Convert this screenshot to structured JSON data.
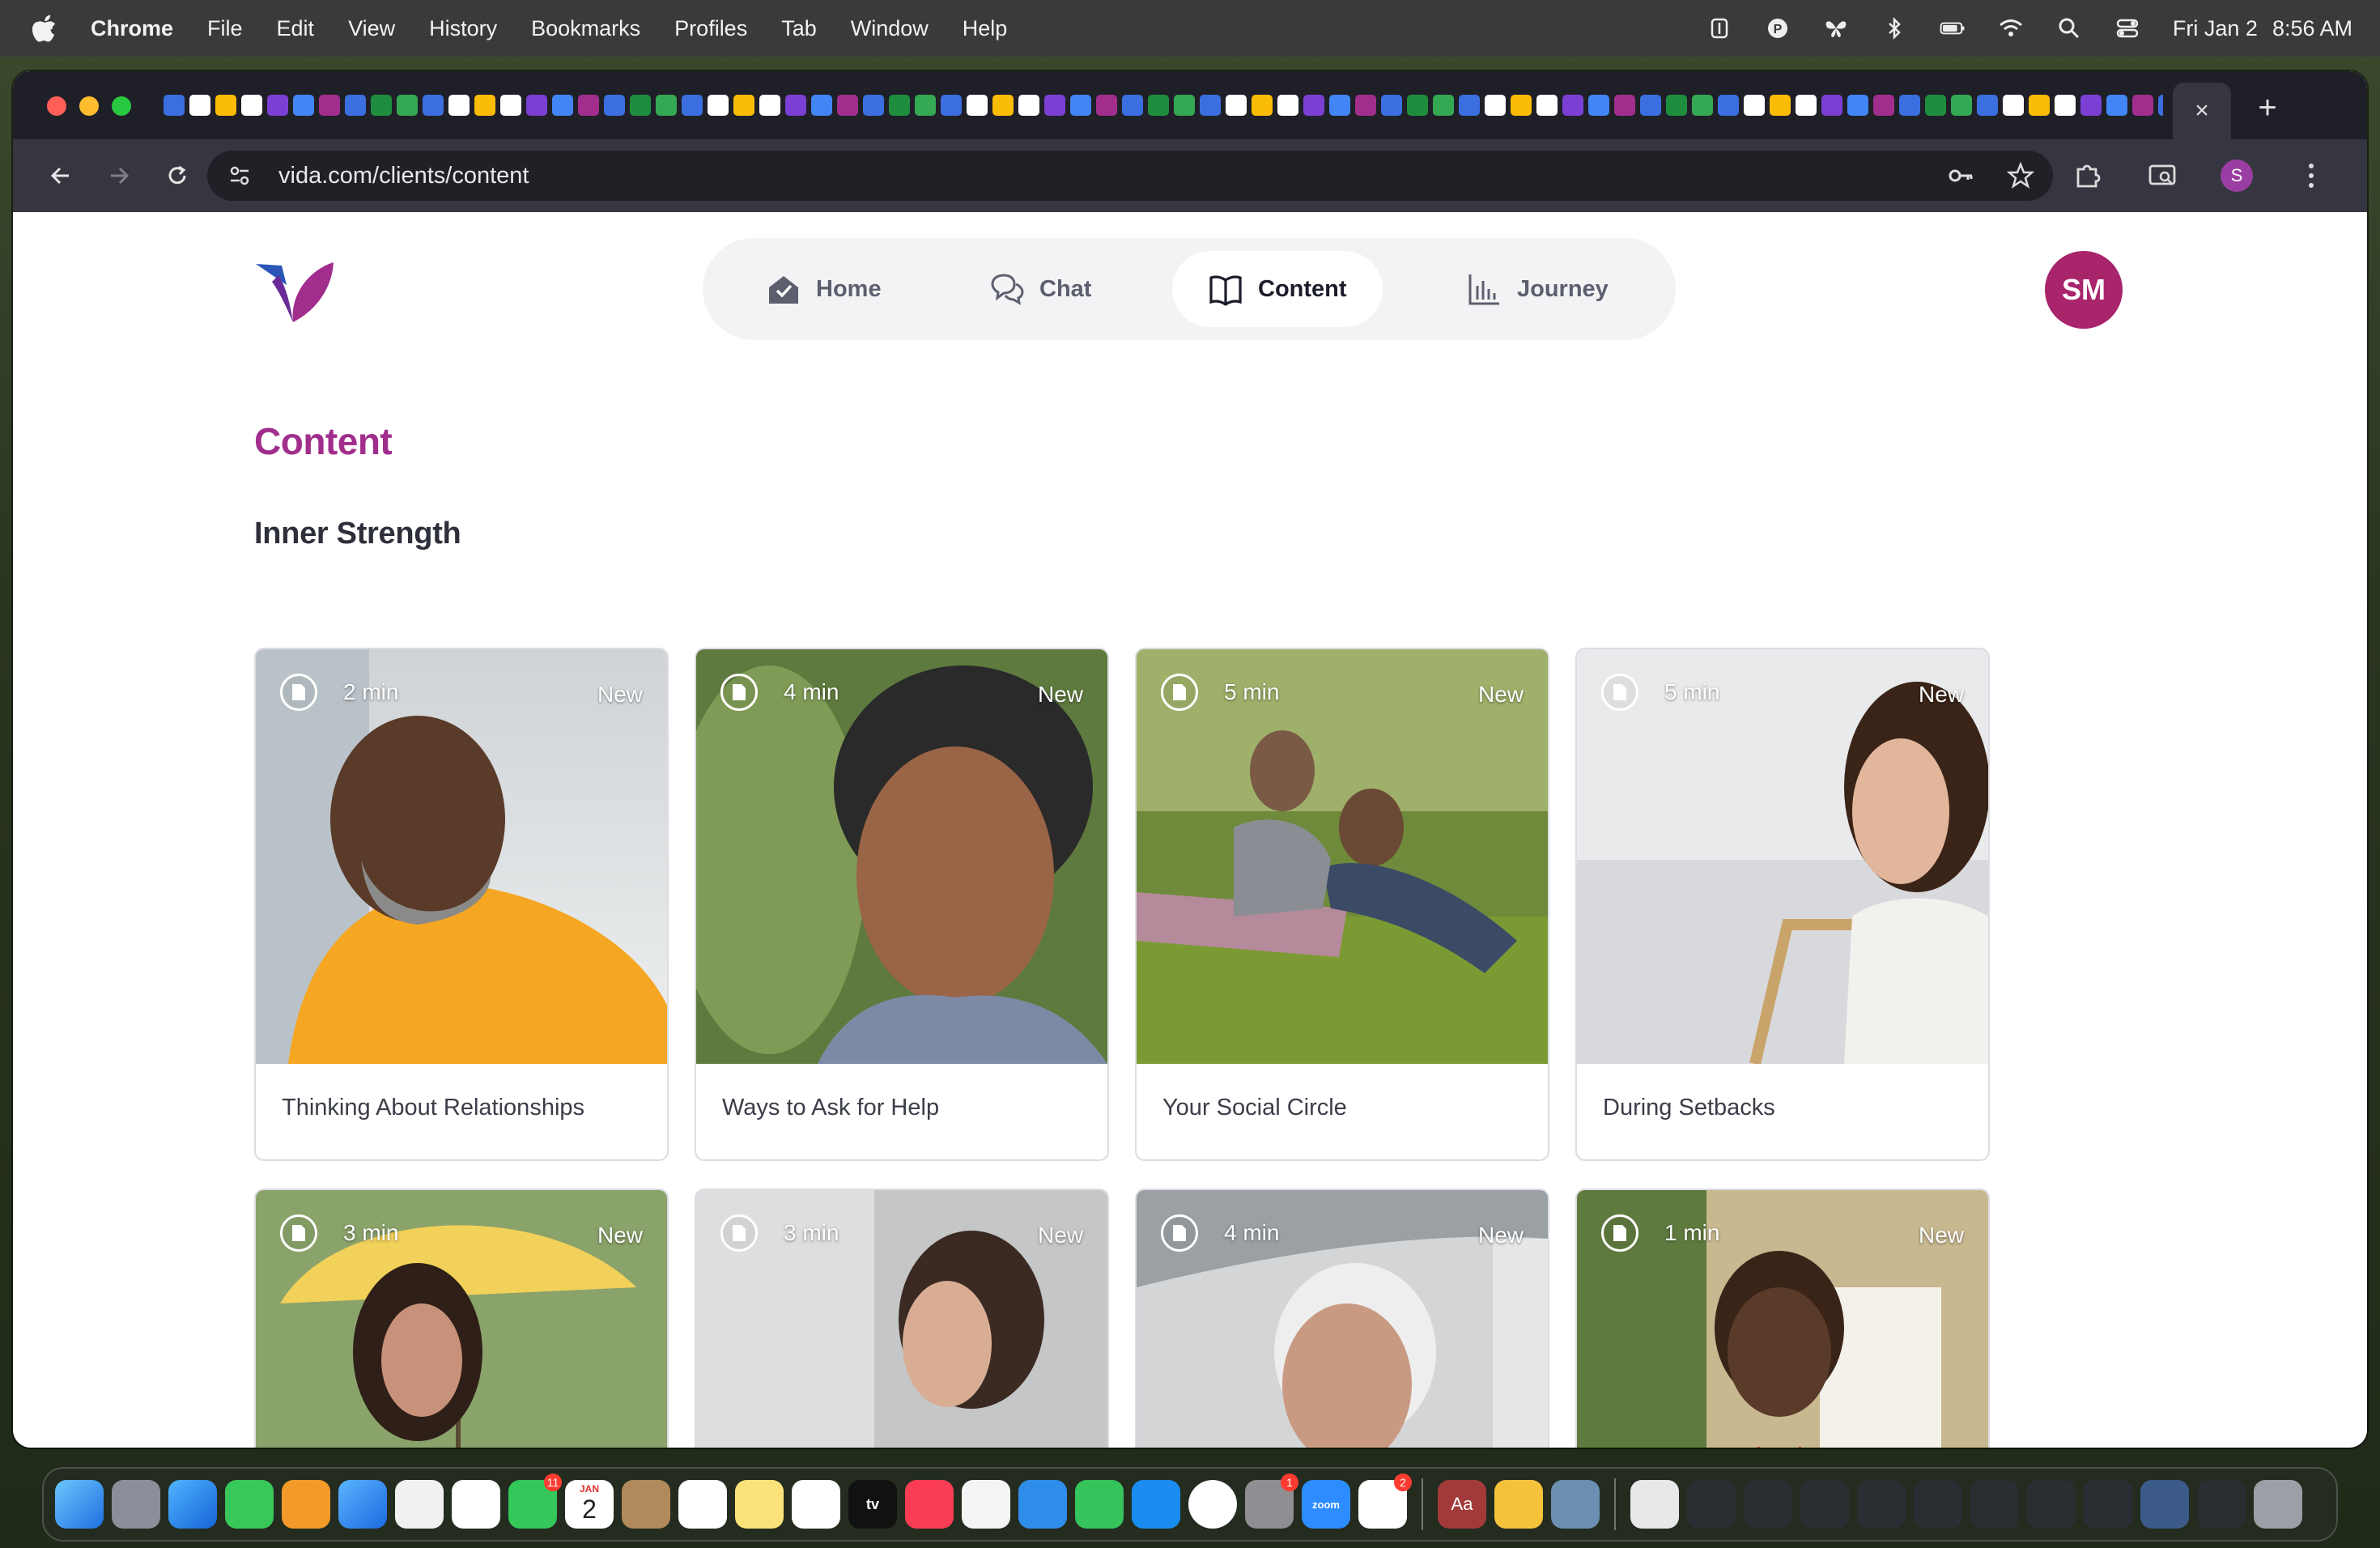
{
  "menubar": {
    "app_name": "Chrome",
    "items": [
      "File",
      "Edit",
      "View",
      "History",
      "Bookmarks",
      "Profiles",
      "Tab",
      "Window",
      "Help"
    ],
    "date": "Fri Jan 2",
    "time": "8:56 AM"
  },
  "browser": {
    "url": "vida.com/clients/content",
    "profile_initial": "S",
    "tab_close": "×",
    "new_tab": "+"
  },
  "nav": {
    "items": [
      {
        "label": "Home",
        "icon": "home-icon"
      },
      {
        "label": "Chat",
        "icon": "chat-icon"
      },
      {
        "label": "Content",
        "icon": "book-icon",
        "active": true
      },
      {
        "label": "Journey",
        "icon": "bar-chart-icon"
      }
    ],
    "avatar_initials": "SM"
  },
  "page": {
    "title": "Content",
    "section_title": "Inner Strength"
  },
  "cards": [
    {
      "duration": "2 min",
      "badge": "New",
      "title": "Thinking About Relationships"
    },
    {
      "duration": "4 min",
      "badge": "New",
      "title": "Ways to Ask for Help"
    },
    {
      "duration": "5 min",
      "badge": "New",
      "title": "Your Social Circle"
    },
    {
      "duration": "5 min",
      "badge": "New",
      "title": "During Setbacks"
    },
    {
      "duration": "3 min",
      "badge": "New",
      "title": ""
    },
    {
      "duration": "3 min",
      "badge": "New",
      "title": ""
    },
    {
      "duration": "4 min",
      "badge": "New",
      "title": ""
    },
    {
      "duration": "1 min",
      "badge": "New",
      "title": ""
    }
  ],
  "dock": {
    "badges": {
      "facetime": "11",
      "settings": "1",
      "slack": "2"
    },
    "calendar_day": "2",
    "calendar_month": "JAN",
    "appletv_label": "tv",
    "zoom_label": "zoom",
    "dictionary_label": "Aa"
  },
  "colors": {
    "brand_purple": "#a12e8c",
    "avatar": "#a8246b",
    "chrome_dark": "#35363f"
  }
}
